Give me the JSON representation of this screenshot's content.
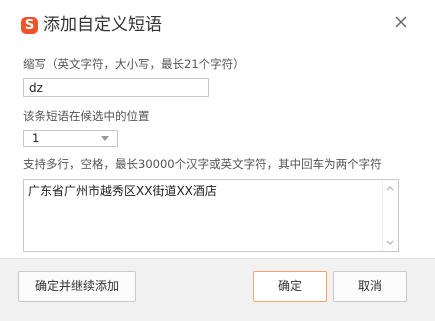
{
  "dialog": {
    "title": "添加自定义短语",
    "logo_char": "S",
    "close_icon": "close-icon"
  },
  "abbreviation": {
    "label": "缩写（英文字符，大小写，最长21个字符）",
    "value": "dz"
  },
  "position": {
    "label": "该条短语在候选中的位置",
    "selected": "1"
  },
  "content": {
    "label": "支持多行，空格，最长30000个汉字或英文字符，其中回车为两个字符",
    "value": "广东省广州市越秀区XX街道XX酒店"
  },
  "buttons": {
    "confirm_and_continue": "确定并继续添加",
    "confirm": "确定",
    "cancel": "取消"
  },
  "colors": {
    "logo": "#f0532a",
    "primary_border": "#f2a56b"
  }
}
